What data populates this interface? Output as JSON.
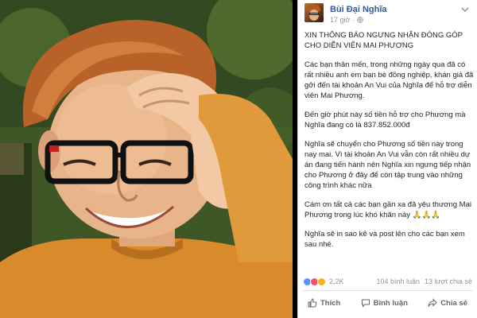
{
  "post": {
    "author": "Bùi Đại Nghĩa",
    "time": "17 giờ",
    "privacy_icon": "globe-icon",
    "paragraphs": [
      "XIN THÔNG BÁO NGƯNG NHẬN ĐÓNG GÓP CHO DIỄN VIÊN MAI PHƯƠNG",
      "Các bạn thân mến, trong những ngày qua đã có rất nhiều anh em bạn bè đồng nghiệp, khán giả đã gởi đến tài khoản An Vui của Nghĩa để hỗ trợ diễn viên Mai Phương.",
      "Đến giờ phút này số tiền hỗ trợ cho Phương mà Nghĩa đang có là 837.852.000đ",
      "Nghĩa sẽ chuyển cho Phương số tiền này trong nay mai. Vì tài khoản An Vui vẫn còn rất nhiều dự án đang tiến hành nên Nghĩa xin ngưng tiếp nhận cho Phương ở đây để còn tập trung vào những công trình khác nữa",
      "Cám ơn tất cả các bạn gần xa đã yêu thương Mai Phương trong lúc khó khăn này 🙏🙏🙏",
      "Nghĩa sẽ in sao kê và post lên cho các bạn xem sau nhé."
    ]
  },
  "reactions": {
    "icons": [
      "like-reaction-icon",
      "love-reaction-icon",
      "sad-reaction-icon"
    ],
    "count": "2,2K",
    "comments": "104 bình luận",
    "shares": "13 lượt chia sẻ"
  },
  "actions": {
    "like_label": "Thích",
    "comment_label": "Bình luận",
    "share_label": "Chia sẻ"
  },
  "colors": {
    "name": "#365899",
    "meta": "#90949c",
    "body": "#1d2129",
    "like": "#5890ff",
    "love": "#f25268",
    "sad": "#f7b125"
  }
}
